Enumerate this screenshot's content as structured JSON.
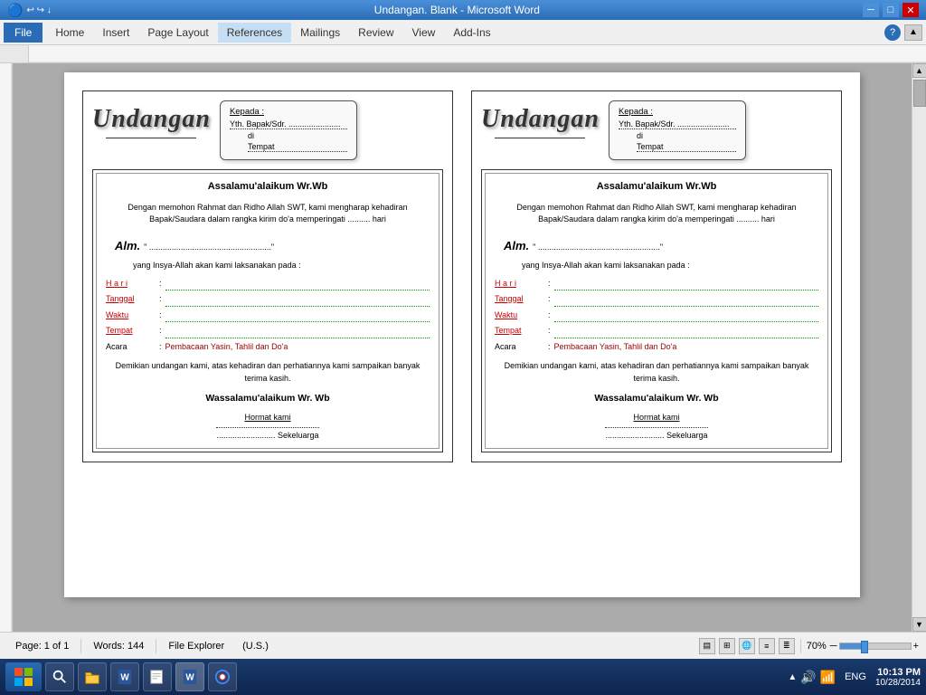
{
  "titlebar": {
    "title": "Undangan. Blank - Microsoft Word",
    "minimize": "─",
    "maximize": "□",
    "close": "✕"
  },
  "menubar": {
    "file": "File",
    "items": [
      "Home",
      "Insert",
      "Page Layout",
      "References",
      "Mailings",
      "Review",
      "View",
      "Add-Ins"
    ]
  },
  "invitation": {
    "logo": "Undangan",
    "address": {
      "to": "Kepada :",
      "name": "Yth. Bapak/Sdr. .......................",
      "di": "di",
      "place": "Tempat"
    },
    "assalamu": "Assalamu'alaikum Wr.Wb",
    "opening": "Dengan memohon Rahmat dan Ridho Allah SWT, kami mengharap kehadiran Bapak/Saudara dalam rangka kirim do'a memperingati .......... hari",
    "alm": "Alm.",
    "quote_open": "\" .......................................................",
    "quote_close": "\"",
    "yang_insya": "yang Insya-Allah akan kami laksanakan pada :",
    "fields": {
      "hari": "H a r i",
      "tanggal": "Tanggal",
      "waktu": "Waktu",
      "tempat": "Tempat",
      "acara": "Acara",
      "colon": ":",
      "acara_value": "Pembacaan Yasin, Tahlil dan Do'a"
    },
    "closing": "Demikian undangan kami, atas kehadiran dan perhatiannya kami sampaikan banyak terima kasih.",
    "wassalamu": "Wassalamu'alaikum Wr. Wb",
    "hormat": "Hormat kami",
    "sekeluarga": ".......................... Sekeluarga"
  },
  "statusbar": {
    "page": "Page: 1 of 1",
    "words": "Words: 144",
    "language": "(U.S.)",
    "fileexplorer": "File Explorer",
    "zoom": "70%"
  },
  "taskbar": {
    "time": "10:13 PM",
    "date": "10/28/2014",
    "lang": "ENG",
    "buttons": [
      "Search",
      "File Explorer",
      "Word",
      "Chrome"
    ]
  }
}
